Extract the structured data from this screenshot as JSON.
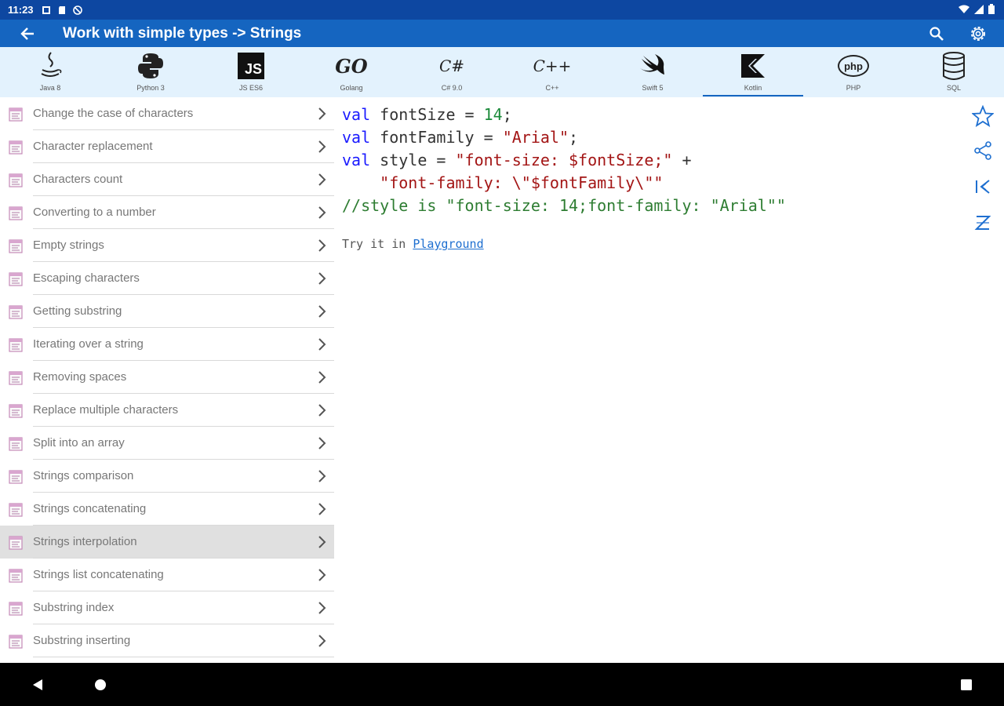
{
  "status": {
    "time": "11:23"
  },
  "app_bar": {
    "title": "Work with simple types -> Strings"
  },
  "languages": [
    {
      "label": "Java 8",
      "icon": "java-icon"
    },
    {
      "label": "Python 3",
      "icon": "python-icon"
    },
    {
      "label": "JS ES6",
      "icon": "javascript-icon",
      "text": "JS"
    },
    {
      "label": "Golang",
      "icon": "golang-icon",
      "text": "GO"
    },
    {
      "label": "C# 9.0",
      "icon": "csharp-icon",
      "text": "C#"
    },
    {
      "label": "C++",
      "icon": "cpp-icon",
      "text": "C++"
    },
    {
      "label": "Swift 5",
      "icon": "swift-icon"
    },
    {
      "label": "Kotlin",
      "icon": "kotlin-icon",
      "active": true
    },
    {
      "label": "PHP",
      "icon": "php-icon",
      "text": "php"
    },
    {
      "label": "SQL",
      "icon": "sql-database-icon"
    }
  ],
  "sidebar": {
    "items": [
      {
        "label": "Change the case of characters"
      },
      {
        "label": "Character replacement"
      },
      {
        "label": "Characters count"
      },
      {
        "label": "Converting to a number"
      },
      {
        "label": "Empty strings"
      },
      {
        "label": "Escaping characters"
      },
      {
        "label": "Getting substring"
      },
      {
        "label": "Iterating over a string"
      },
      {
        "label": "Removing spaces"
      },
      {
        "label": "Replace multiple characters"
      },
      {
        "label": "Split into an array"
      },
      {
        "label": "Strings comparison"
      },
      {
        "label": "Strings concatenating"
      },
      {
        "label": "Strings interpolation",
        "selected": true
      },
      {
        "label": "Strings list concatenating"
      },
      {
        "label": "Substring index"
      },
      {
        "label": "Substring inserting"
      }
    ]
  },
  "code": {
    "lines": [
      [
        {
          "c": "kw",
          "t": "val"
        },
        {
          "c": "id",
          "t": " fontSize = "
        },
        {
          "c": "num",
          "t": "14"
        },
        {
          "c": "id",
          "t": ";"
        }
      ],
      [
        {
          "c": "kw",
          "t": "val"
        },
        {
          "c": "id",
          "t": " fontFamily = "
        },
        {
          "c": "str",
          "t": "\"Arial\""
        },
        {
          "c": "id",
          "t": ";"
        }
      ],
      [
        {
          "c": "kw",
          "t": "val"
        },
        {
          "c": "id",
          "t": " style = "
        },
        {
          "c": "str",
          "t": "\"font-size: $fontSize;\""
        },
        {
          "c": "id",
          "t": " +"
        }
      ],
      [
        {
          "c": "id",
          "t": "    "
        },
        {
          "c": "str",
          "t": "\"font-family: \\\"$fontFamily\\\"\""
        }
      ],
      [
        {
          "c": "cmt",
          "t": "//style is \"font-size: 14;font-family: \"Arial\"\""
        }
      ]
    ],
    "try_prefix": "Try it in ",
    "try_link": "Playground"
  },
  "colors": {
    "status_bar": "#0d47a1",
    "app_bar": "#1565c0",
    "lang_bar": "#e3f2fd",
    "selected_row": "#e0e0e0",
    "tool_icon": "#1e6fd0"
  }
}
